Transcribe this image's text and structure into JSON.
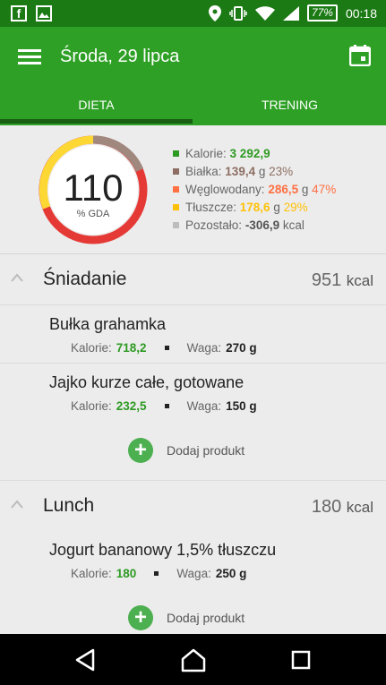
{
  "status_bar": {
    "icons": [
      "facebook-icon",
      "image-icon",
      "location-icon",
      "vibrate-icon",
      "wifi-icon",
      "signal-icon",
      "battery-icon"
    ],
    "battery": "77%",
    "time": "00:18"
  },
  "app_bar": {
    "title": "Środa, 29 lipca"
  },
  "tabs": [
    {
      "label": "DIETA",
      "selected": true
    },
    {
      "label": "TRENING",
      "selected": false
    }
  ],
  "summary": {
    "gauge_value": "110",
    "gauge_label": "% GDA",
    "legend": [
      {
        "label": "Kalorie:",
        "value": "3 292,9",
        "unit": "",
        "percent": "",
        "color": "#2e9a23"
      },
      {
        "label": "Białka:",
        "value": "139,4",
        "unit": "g",
        "percent": "23%",
        "color": "#8d6e63"
      },
      {
        "label": "Węglowodany:",
        "value": "286,5",
        "unit": "g",
        "percent": "47%",
        "color": "#ff7043"
      },
      {
        "label": "Tłuszcze:",
        "value": "178,6",
        "unit": "g",
        "percent": "29%",
        "color": "#ffc107"
      },
      {
        "label": "Pozostało:",
        "value": "-306,9",
        "unit": "kcal",
        "percent": "",
        "color": "#bdbdbd"
      }
    ]
  },
  "meals": [
    {
      "name": "Śniadanie",
      "kcal": "951",
      "kcal_unit": "kcal",
      "items": [
        {
          "name": "Bułka grahamka",
          "cal_label": "Kalorie:",
          "cal": "718,2",
          "weight_label": "Waga:",
          "weight": "270 g"
        },
        {
          "name": "Jajko kurze całe, gotowane",
          "cal_label": "Kalorie:",
          "cal": "232,5",
          "weight_label": "Waga:",
          "weight": "150 g"
        }
      ],
      "add_label": "Dodaj produkt"
    },
    {
      "name": "Lunch",
      "kcal": "180",
      "kcal_unit": "kcal",
      "items": [
        {
          "name": "Jogurt bananowy 1,5% tłuszczu",
          "cal_label": "Kalorie:",
          "cal": "180",
          "weight_label": "Waga:",
          "weight": "250 g"
        }
      ],
      "add_label": "Dodaj produkt"
    }
  ],
  "colors": {
    "app_green": "#2ea025",
    "status_green": "#1b7a14",
    "gauge_red": "#e53935",
    "gauge_yellow": "#fdd835",
    "gauge_brown": "#8d6e63",
    "calorie_green": "#2e9a23"
  }
}
